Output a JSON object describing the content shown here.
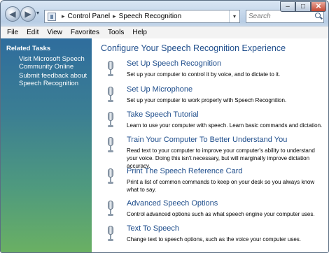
{
  "window": {
    "address": {
      "crumbs": [
        "Control Panel",
        "Speech Recognition"
      ]
    },
    "search_placeholder": "Search",
    "caption_buttons": {
      "minimize": "–",
      "maximize": "□",
      "close": "✕"
    }
  },
  "menu": [
    "File",
    "Edit",
    "View",
    "Favorites",
    "Tools",
    "Help"
  ],
  "sidebar": {
    "heading": "Related Tasks",
    "links": [
      "Visit Microsoft Speech Community Online",
      "Submit feedback about Speech Recognition"
    ]
  },
  "main": {
    "title": "Configure Your Speech Recognition Experience",
    "tasks": [
      {
        "title": "Set Up Speech Recognition",
        "desc": "Set up your computer to control it by voice, and to dictate to it."
      },
      {
        "title": "Set Up Microphone",
        "desc": "Set up your computer to work properly with Speech Recognition."
      },
      {
        "title": "Take Speech Tutorial",
        "desc": "Learn to use your computer with speech.  Learn basic commands and dictation."
      },
      {
        "title": "Train Your Computer To Better Understand You",
        "desc": "Read text to your computer to improve your computer's ability to understand your voice.  Doing this isn't necessary, but will marginally improve dictation accuracy."
      },
      {
        "title": "Print The Speech Reference Card",
        "desc": "Print a list of common commands to keep on your desk so you always know what to say."
      },
      {
        "title": "Advanced Speech Options",
        "desc": "Control advanced options such as what speech engine your computer uses."
      },
      {
        "title": "Text To Speech",
        "desc": "Change text to speech options, such as the voice your computer uses."
      }
    ]
  }
}
